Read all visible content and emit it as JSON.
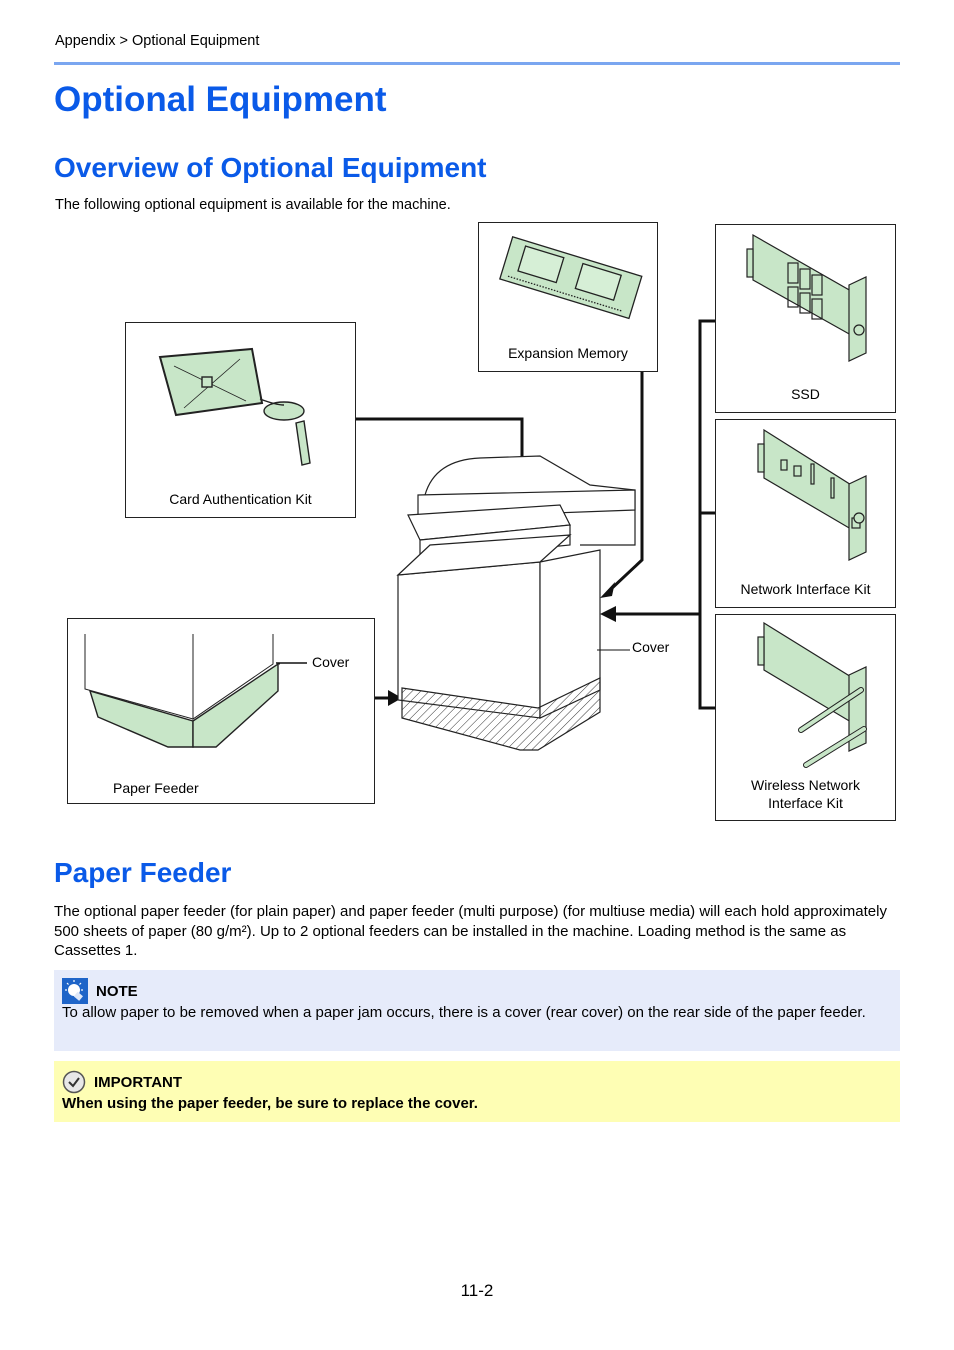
{
  "header": {
    "breadcrumb": "Appendix > Optional Equipment"
  },
  "page_title": "Optional Equipment",
  "overview": {
    "heading": "Overview of Optional Equipment",
    "intro": "The following optional equipment is available for the machine.",
    "items": {
      "expansion_memory": "Expansion Memory",
      "ssd": "SSD",
      "network_interface_kit": "Network Interface Kit",
      "wireless_network_line1": "Wireless Network",
      "wireless_network_line2": "Interface Kit",
      "card_authentication_kit": "Card Authentication Kit",
      "paper_feeder": "Paper Feeder"
    },
    "callouts": {
      "feeder_cover": "Cover",
      "machine_cover": "Cover"
    },
    "colors": {
      "part_fill": "#c8e6c8",
      "heading": "#0a5ae8"
    }
  },
  "paper_feeder": {
    "heading": "Paper Feeder",
    "paragraph": "The optional paper feeder (for plain paper) and paper feeder (multi purpose) (for multiuse media) will each hold approximately 500 sheets of paper (80 g/m²). Up to 2 optional feeders can be installed in the machine. Loading method is the same as Cassettes 1.",
    "note": {
      "icon": "lightbulb-icon",
      "title": "NOTE",
      "body": "To allow paper to be removed when a paper jam occurs, there is a cover (rear cover) on the rear side of the paper feeder."
    },
    "important": {
      "icon": "check-circle-icon",
      "title": "IMPORTANT",
      "body": "When using the paper feeder, be sure to replace the cover."
    }
  },
  "footer": {
    "page_number": "11-2"
  }
}
